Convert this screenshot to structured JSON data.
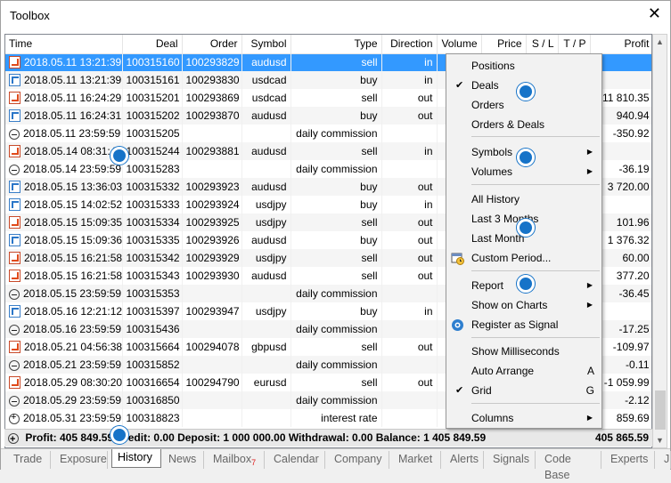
{
  "window": {
    "title": "Toolbox",
    "close_glyph": "✕"
  },
  "columns": [
    "Time",
    "Deal",
    "Order",
    "Symbol",
    "Type",
    "Direction",
    "Volume",
    "Price",
    "S / L",
    "T / P",
    "Profit"
  ],
  "rows": [
    {
      "icon": "sell-icon",
      "time": "2018.05.11 13:21:39",
      "deal": "100315160",
      "order": "100293829",
      "symbol": "audusd",
      "type": "sell",
      "dir": "in",
      "profit": ""
    },
    {
      "icon": "buy-icon",
      "time": "2018.05.11 13:21:39",
      "deal": "100315161",
      "order": "100293830",
      "symbol": "usdcad",
      "type": "buy",
      "dir": "in",
      "profit": ""
    },
    {
      "icon": "sell-icon",
      "time": "2018.05.11 16:24:29",
      "deal": "100315201",
      "order": "100293869",
      "symbol": "usdcad",
      "type": "sell",
      "dir": "out",
      "profit": "11 810.35"
    },
    {
      "icon": "buy-icon",
      "time": "2018.05.11 16:24:31",
      "deal": "100315202",
      "order": "100293870",
      "symbol": "audusd",
      "type": "buy",
      "dir": "out",
      "profit": "940.94"
    },
    {
      "icon": "commission-icon",
      "time": "2018.05.11 23:59:59",
      "deal": "100315205",
      "order": "",
      "symbol": "",
      "type": "daily commission",
      "dir": "",
      "profit": "-350.92"
    },
    {
      "icon": "sell-icon",
      "time": "2018.05.14 08:31:46",
      "deal": "100315244",
      "order": "100293881",
      "symbol": "audusd",
      "type": "sell",
      "dir": "in",
      "profit": ""
    },
    {
      "icon": "commission-icon",
      "time": "2018.05.14 23:59:59",
      "deal": "100315283",
      "order": "",
      "symbol": "",
      "type": "daily commission",
      "dir": "",
      "profit": "-36.19"
    },
    {
      "icon": "buy-icon",
      "time": "2018.05.15 13:36:03",
      "deal": "100315332",
      "order": "100293923",
      "symbol": "audusd",
      "type": "buy",
      "dir": "out",
      "profit": "3 720.00"
    },
    {
      "icon": "buy-icon",
      "time": "2018.05.15 14:02:52",
      "deal": "100315333",
      "order": "100293924",
      "symbol": "usdjpy",
      "type": "buy",
      "dir": "in",
      "profit": ""
    },
    {
      "icon": "sell-icon",
      "time": "2018.05.15 15:09:35",
      "deal": "100315334",
      "order": "100293925",
      "symbol": "usdjpy",
      "type": "sell",
      "dir": "out",
      "profit": "101.96"
    },
    {
      "icon": "buy-icon",
      "time": "2018.05.15 15:09:36",
      "deal": "100315335",
      "order": "100293926",
      "symbol": "audusd",
      "type": "buy",
      "dir": "out",
      "profit": "1 376.32"
    },
    {
      "icon": "sell-icon",
      "time": "2018.05.15 16:21:58",
      "deal": "100315342",
      "order": "100293929",
      "symbol": "usdjpy",
      "type": "sell",
      "dir": "out",
      "profit": "60.00"
    },
    {
      "icon": "sell-icon",
      "time": "2018.05.15 16:21:58",
      "deal": "100315343",
      "order": "100293930",
      "symbol": "audusd",
      "type": "sell",
      "dir": "out",
      "profit": "377.20"
    },
    {
      "icon": "commission-icon",
      "time": "2018.05.15 23:59:59",
      "deal": "100315353",
      "order": "",
      "symbol": "",
      "type": "daily commission",
      "dir": "",
      "profit": "-36.45"
    },
    {
      "icon": "buy-icon",
      "time": "2018.05.16 12:21:12",
      "deal": "100315397",
      "order": "100293947",
      "symbol": "usdjpy",
      "type": "buy",
      "dir": "in",
      "profit": ""
    },
    {
      "icon": "commission-icon",
      "time": "2018.05.16 23:59:59",
      "deal": "100315436",
      "order": "",
      "symbol": "",
      "type": "daily commission",
      "dir": "",
      "profit": "-17.25"
    },
    {
      "icon": "sell-icon",
      "time": "2018.05.21 04:56:38",
      "deal": "100315664",
      "order": "100294078",
      "symbol": "gbpusd",
      "type": "sell",
      "dir": "out",
      "profit": "-109.97"
    },
    {
      "icon": "commission-icon",
      "time": "2018.05.21 23:59:59",
      "deal": "100315852",
      "order": "",
      "symbol": "",
      "type": "daily commission",
      "dir": "",
      "profit": "-0.11"
    },
    {
      "icon": "sell-icon",
      "time": "2018.05.29 08:30:20",
      "deal": "100316654",
      "order": "100294790",
      "symbol": "eurusd",
      "type": "sell",
      "dir": "out",
      "profit": "-1 059.99"
    },
    {
      "icon": "commission-icon",
      "time": "2018.05.29 23:59:59",
      "deal": "100316850",
      "order": "",
      "symbol": "",
      "type": "daily commission",
      "dir": "",
      "profit": "-2.12"
    },
    {
      "icon": "plus-icon",
      "time": "2018.05.31 23:59:59",
      "deal": "100318823",
      "order": "",
      "symbol": "",
      "type": "interest rate",
      "dir": "",
      "profit": "859.69"
    }
  ],
  "summary": {
    "text": "Profit: 405 849.59  Credit: 0.00  Deposit: 1 000 000.00  Withdrawal: 0.00  Balance: 1 405 849.59",
    "total": "405 865.59"
  },
  "tabs": [
    {
      "label": "Trade",
      "badge": ""
    },
    {
      "label": "Exposure",
      "badge": ""
    },
    {
      "label": "History",
      "badge": "",
      "active": true
    },
    {
      "label": "News",
      "badge": ""
    },
    {
      "label": "Mailbox",
      "badge": "7"
    },
    {
      "label": "Calendar",
      "badge": ""
    },
    {
      "label": "Company",
      "badge": ""
    },
    {
      "label": "Market",
      "badge": ""
    },
    {
      "label": "Alerts",
      "badge": ""
    },
    {
      "label": "Signals",
      "badge": ""
    },
    {
      "label": "Code Base",
      "badge": ""
    },
    {
      "label": "Experts",
      "badge": ""
    },
    {
      "label": "J",
      "badge": ""
    }
  ],
  "menu": {
    "positions": "Positions",
    "deals": "Deals",
    "orders": "Orders",
    "orders_deals": "Orders & Deals",
    "symbols": "Symbols",
    "volumes": "Volumes",
    "all_history": "All History",
    "last3": "Last 3 Months",
    "last_month": "Last Month",
    "custom_period": "Custom Period...",
    "report": "Report",
    "show_on_charts": "Show on Charts",
    "register_signal": "Register as Signal",
    "show_ms": "Show Milliseconds",
    "auto_arrange": "Auto Arrange",
    "auto_arrange_key": "A",
    "grid": "Grid",
    "grid_key": "G",
    "columns": "Columns",
    "check_glyph": "✔",
    "arrow_glyph": "▶"
  }
}
